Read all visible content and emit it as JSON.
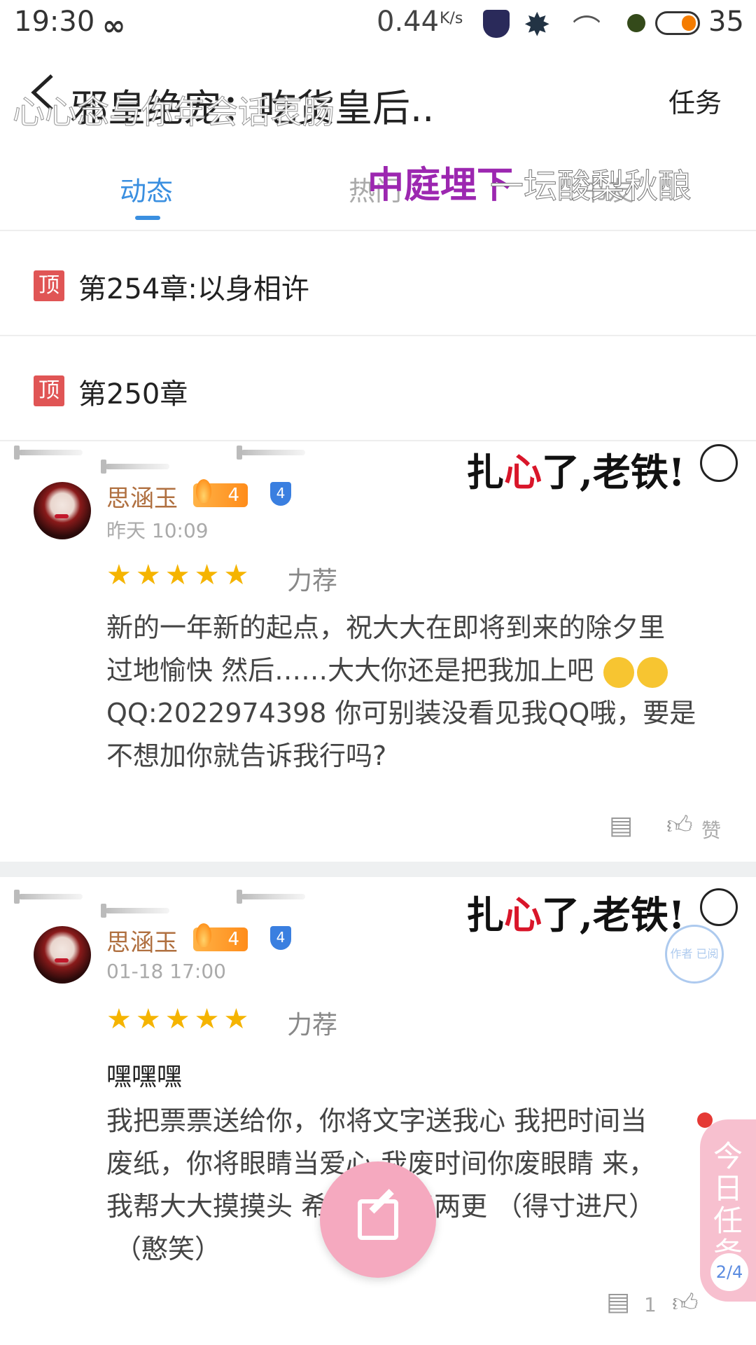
{
  "status_bar": {
    "time": "19:30",
    "network_speed": "0.44",
    "network_unit": "K/s",
    "battery": "35"
  },
  "header": {
    "title": "邪皇绝宠：吃货皇后..",
    "task_label": "任务",
    "danmaku_overlay": "心心念与你年会话衷肠"
  },
  "tabs": [
    {
      "label": "动态",
      "active": true
    },
    {
      "label": "热门",
      "active": false
    },
    {
      "label": "书友",
      "active": false
    }
  ],
  "danmaku": {
    "purple": "中庭埋下",
    "white": "一坛酸梨秋酿"
  },
  "pinned": [
    {
      "badge": "顶",
      "text": "第254章:以身相许"
    },
    {
      "badge": "顶",
      "text": "第250章"
    }
  ],
  "posts": [
    {
      "banner": "扎心了,老铁!",
      "banner_red": "心",
      "username": "思涵玉",
      "level": "4",
      "badge": "4",
      "time": "昨天 10:09",
      "stars": "★★★★★",
      "recommend": "力荐",
      "title": "",
      "body_lines": [
        "新的一年新的起点，祝大大在即将到来的除夕里",
        "过地愉快 然后……大大你还是把我加上吧",
        "QQ:2022974398 你可别装没看见我QQ哦，要是",
        "不想加你就告诉我行吗?"
      ],
      "like_label": "赞",
      "comment_count": ""
    },
    {
      "banner": "扎心了,老铁!",
      "banner_red": "心",
      "username": "思涵玉",
      "level": "4",
      "badge": "4",
      "time": "01-18 17:00",
      "stars": "★★★★★",
      "recommend": "力荐",
      "title": "嘿嘿嘿",
      "stamp": "作者 已阅",
      "body_lines": [
        "我把票票送给你，你将文字送我心 我把时间当",
        "废纸，你将眼睛当爱心 我废时间你废眼睛 来，",
        "我帮大大摸摸头 希望大大能两更 （得寸进尺）",
        "（憨笑）"
      ],
      "comment_count": "1"
    }
  ],
  "daily_task": {
    "label": "今日任务",
    "progress": "2/4"
  },
  "colors": {
    "tab_active": "#3a8fe0",
    "pin_badge": "#e05555",
    "fab": "#f5a9bf",
    "stars": "#f5b400"
  }
}
